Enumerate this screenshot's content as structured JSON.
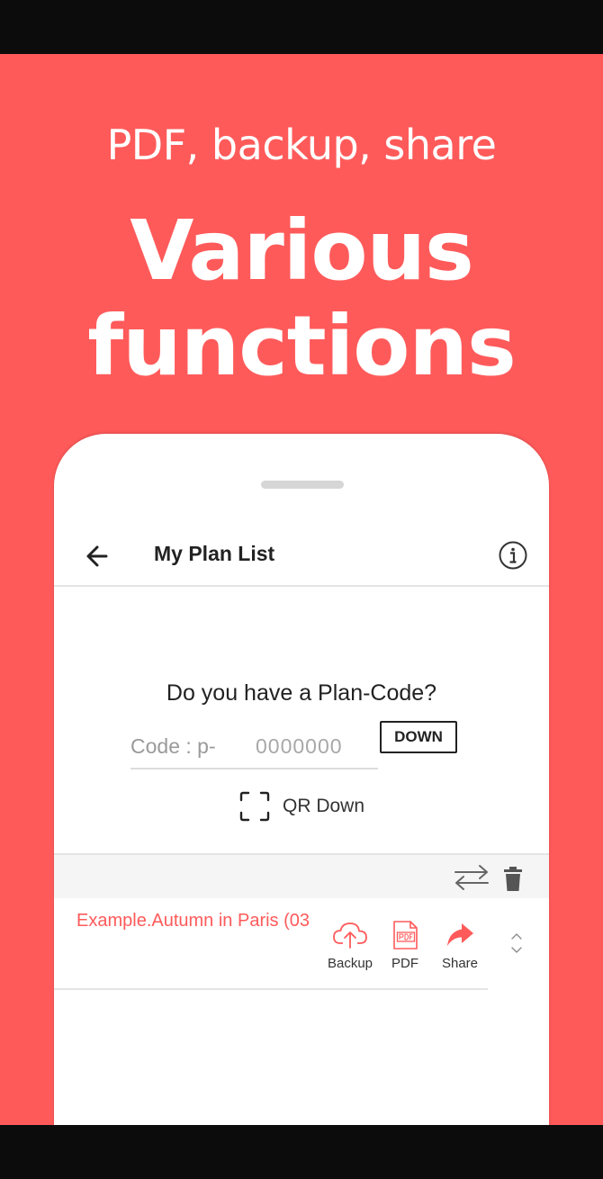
{
  "promo": {
    "subtitle": "PDF, backup, share",
    "headline_line1": "Various",
    "headline_line2": "functions"
  },
  "appbar": {
    "title": "My Plan List",
    "back_icon": "arrow-left-icon",
    "info_icon": "info-icon"
  },
  "plan_code": {
    "question": "Do you have a Plan-Code?",
    "prefix": "Code : p-",
    "input_value": "",
    "input_placeholder": "0000000",
    "down_label": "DOWN",
    "qr_label": "QR Down",
    "qr_icon": "qr-scan-icon"
  },
  "toolbar": {
    "swap_icon": "swap-arrows-icon",
    "trash_icon": "trash-icon"
  },
  "plans": [
    {
      "title": "Example.Autumn in Paris (03",
      "actions": {
        "backup": "Backup",
        "pdf": "PDF",
        "share": "Share"
      }
    }
  ],
  "colors": {
    "accent": "#ff5a5a",
    "text": "#222222",
    "muted": "#9a9a9a",
    "divider": "#e4e4e4"
  }
}
